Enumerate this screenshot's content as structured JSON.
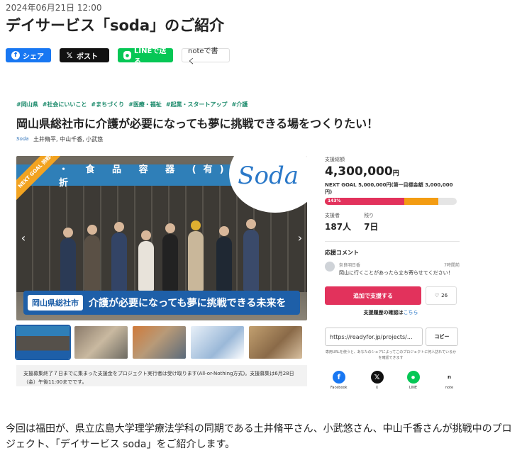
{
  "article": {
    "date": "2024年06月21日 12:00",
    "title": "デイサービス「soda」のご紹介",
    "body": "今回は福田が、県立広島大学理学療法学科の同期である土井脩平さん、小武悠さん、中山千香さんが挑戦中のプロジェクト、「デイサービス soda」をご紹介します。"
  },
  "share": {
    "facebook_label": "シェア",
    "x_label": "ポスト",
    "line_label": "LINEで送る",
    "note_label": "noteで書く"
  },
  "project": {
    "tags": [
      "#岡山県",
      "#社会にいいこと",
      "#まちづくり",
      "#医療・福祉",
      "#起業・スタートアップ",
      "#介護"
    ],
    "title": "岡山県総社市に介護が必要になっても夢に挑戦できる場をつくりたい！",
    "logo_text": "Soda",
    "authors": "土井脩平, 中山千香, 小武悠",
    "hero": {
      "sign": "・ 食 品 容 器 (有) 内 田 折",
      "ribbon": "NEXT GOAL 挑戦中",
      "logo": "Soda",
      "banner_tag": "岡山県総社市",
      "banner_text": "介護が必要になっても夢に挑戦できる未来を"
    },
    "notice": "支援募集終了７日までに集まった支援金をプロジェクト実行者は受け取ります(All-or-Nothing方式)。支援募集は6月28日（金）午後11:00までです。"
  },
  "sidebar": {
    "total_label": "支援総額",
    "total_amount": "4,300,000",
    "total_unit": "円",
    "next_goal": "NEXT GOAL 5,000,000円(第一目標金額 3,000,000円)",
    "progress_text": "143%",
    "progress_percent": 143,
    "supporters_label": "支援者",
    "supporters_value": "187人",
    "remaining_label": "残り",
    "remaining_value": "7日",
    "comments_heading": "応援コメント",
    "comment": {
      "author": "奈良明日香",
      "time": "7時間前",
      "text": "岡山に行くことがあったら立ち寄らせてください！"
    },
    "support_button": "追加で支援する",
    "fav_count": "26",
    "history_text": "支援履歴の確認は",
    "history_link": "こちら",
    "share_url": "https://readyfor.jp/projects/...",
    "copy_button": "コピー",
    "url_note": "専用URLを使うと、あなたのシェアによってこのプロジェクトに何人訪れているかを確認できます",
    "sns": [
      {
        "label": "Facebook",
        "icon": "facebook-icon",
        "color": "#1877f2"
      },
      {
        "label": "X",
        "icon": "x-icon",
        "color": "#111111"
      },
      {
        "label": "LINE",
        "icon": "line-icon",
        "color": "#06c755"
      },
      {
        "label": "note",
        "icon": "note-icon",
        "color": "#ffffff"
      }
    ]
  },
  "colors": {
    "accent_red": "#e2325c",
    "progress_orange": "#f39c12",
    "tag_green": "#1b8a6b",
    "brand_blue": "#2a78c8"
  }
}
